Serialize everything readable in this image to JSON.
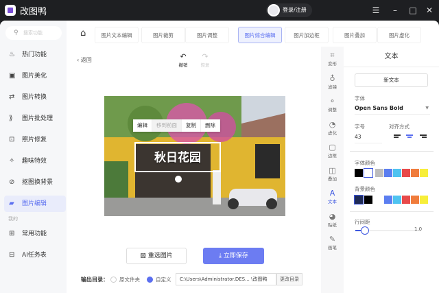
{
  "app": {
    "title": "改图鸭",
    "login": "登录/注册"
  },
  "window": {
    "menu_icon": "menu-icon",
    "min_icon": "minimize-icon",
    "max_icon": "maximize-icon",
    "close_icon": "close-icon"
  },
  "sidebar": {
    "search_placeholder": "搜索功能",
    "items": [
      {
        "label": "热门功能",
        "icon": "fire-icon"
      },
      {
        "label": "图片美化",
        "icon": "image-beautify-icon"
      },
      {
        "label": "图片转换",
        "icon": "convert-icon"
      },
      {
        "label": "图片批处理",
        "icon": "batch-icon"
      },
      {
        "label": "照片修复",
        "icon": "repair-icon"
      },
      {
        "label": "趣味特效",
        "icon": "effects-icon"
      },
      {
        "label": "抠图换背景",
        "icon": "cutout-icon"
      },
      {
        "label": "图片编辑",
        "icon": "edit-icon"
      }
    ],
    "section_mine": "我的",
    "mine_items": [
      {
        "label": "常用功能",
        "icon": "grid-icon"
      },
      {
        "label": "AI任务表",
        "icon": "task-icon"
      }
    ]
  },
  "tabs": [
    "图片文本编辑",
    "图片裁剪",
    "图片调整",
    "图片综合编辑",
    "图片加边框",
    "图片叠加",
    "图片虚化"
  ],
  "active_tab": "图片综合编辑",
  "editor": {
    "back": "返回",
    "undo": "撤销",
    "redo": "恢复",
    "context_menu": [
      "编辑",
      "移到前面",
      "复制",
      "删除"
    ],
    "overlay_text": "秋日花园",
    "reselect": "重选图片",
    "save": "立即保存",
    "output_label": "输出目录：",
    "opt_original": "原文件夹",
    "opt_custom": "自定义",
    "path": "C:\\Users\\Administrator.DES... \\改图鸭",
    "change_dir": "更改目录"
  },
  "tools": [
    {
      "label": "变形",
      "icon": "crop-icon"
    },
    {
      "label": "滤镜",
      "icon": "filter-icon"
    },
    {
      "label": "调整",
      "icon": "adjust-icon"
    },
    {
      "label": "虚化",
      "icon": "blur-icon"
    },
    {
      "label": "边框",
      "icon": "border-icon"
    },
    {
      "label": "叠加",
      "icon": "overlay-icon"
    },
    {
      "label": "文本",
      "icon": "text-icon"
    },
    {
      "label": "贴纸",
      "icon": "sticker-icon"
    },
    {
      "label": "画笔",
      "icon": "brush-icon"
    }
  ],
  "panel": {
    "title": "文本",
    "new_text": "新文本",
    "font_label": "字体",
    "font_value": "Open Sans Bold",
    "size_label": "字号",
    "size_value": "43",
    "align_label": "对齐方式",
    "align_selected": "center",
    "font_color_label": "字体颜色",
    "font_colors": [
      "#000000",
      "#ffffff",
      "#bdbdbd",
      "#5b7ef0",
      "#4fc3f0",
      "#e84a4a",
      "#f07c3c",
      "#f7ee3a"
    ],
    "font_color_selected": 1,
    "bg_color_label": "背景颜色",
    "bg_colors": [
      "#1f2b55",
      "#000000",
      "#ffffff",
      "#5b7ef0",
      "#4fc3f0",
      "#e84a4a",
      "#f07c3c",
      "#f7ee3a"
    ],
    "bg_color_selected": 0,
    "line_spacing_label": "行间距",
    "line_spacing_value": "1.0",
    "line_spacing_fraction": 0.15
  },
  "colors": {
    "accent": "#5b6ff0",
    "save": "#6c7cf2"
  }
}
